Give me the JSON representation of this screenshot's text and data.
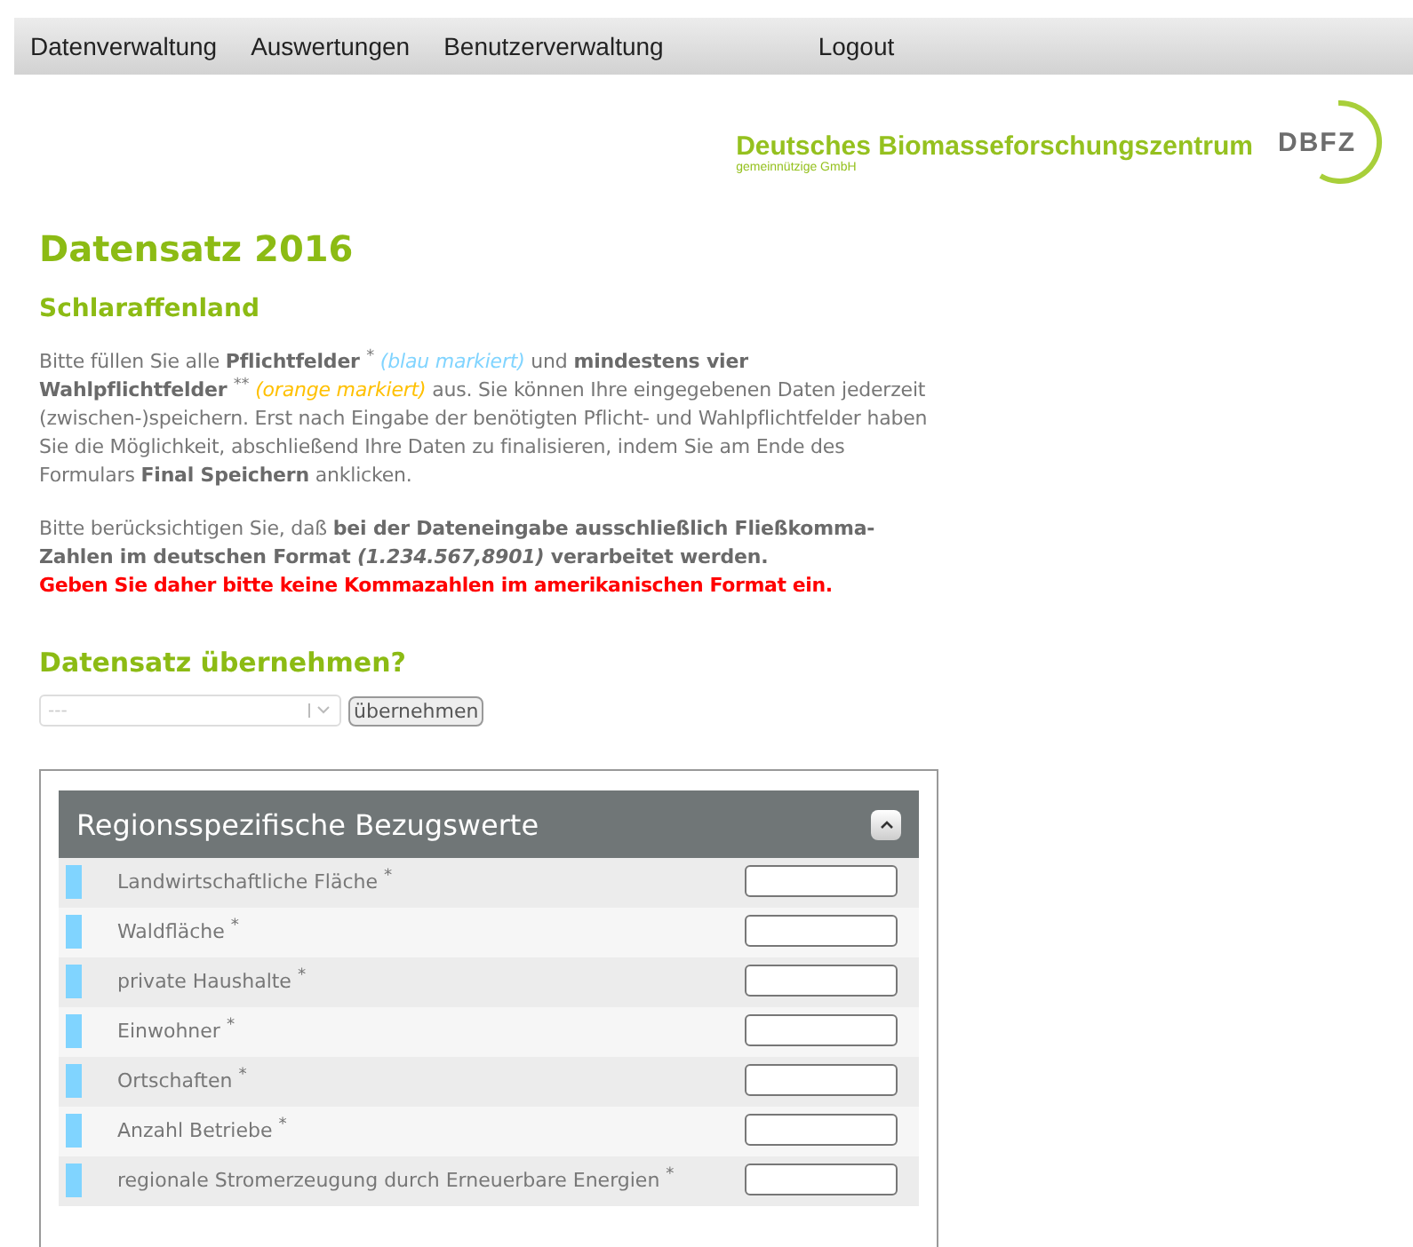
{
  "nav": [
    {
      "label": "Datenverwaltung"
    },
    {
      "label": "Auswertungen"
    },
    {
      "label": "Benutzerverwaltung"
    },
    {
      "label": "Logout"
    }
  ],
  "logo": {
    "name": "Deutsches Biomasseforschungszentrum",
    "subtitle": "gemeinnützige GmbH",
    "mark": "DBFZ"
  },
  "title": "Datensatz 2016",
  "subtitle": "Schlaraffenland",
  "intro": [
    {
      "kind": "plain",
      "text": "Bitte füllen Sie alle "
    },
    {
      "kind": "bold",
      "text": "Pflichtfelder "
    },
    {
      "kind": "sup",
      "text": "*"
    },
    {
      "kind": "blue",
      "text": " (blau markiert)"
    },
    {
      "kind": "plain",
      "text": " und "
    },
    {
      "kind": "bold",
      "text": "mindestens vier Wahlpflichtfelder "
    },
    {
      "kind": "sup",
      "text": "**"
    },
    {
      "kind": "orange",
      "text": " (orange markiert)"
    },
    {
      "kind": "plain",
      "text": " aus. Sie können Ihre eingegebenen Daten jederzeit (zwischen-)speichern. Erst nach Eingabe der benötigten Pflicht- und Wahlpflichtfelder haben Sie die Möglichkeit, abschließend Ihre Daten zu finalisieren, indem Sie am Ende des Formulars "
    },
    {
      "kind": "bold",
      "text": "Final Speichern"
    },
    {
      "kind": "plain",
      "text": " anklicken."
    }
  ],
  "notice": [
    {
      "kind": "plain",
      "text": "Bitte berücksichtigen Sie, daß "
    },
    {
      "kind": "bold",
      "text": "bei der Dateneingabe ausschließlich Fließkomma-Zahlen im deutschen Format "
    },
    {
      "kind": "bolditalic",
      "text": "(1.234.567,8901)"
    },
    {
      "kind": "bold",
      "text": " verarbeitet werden."
    }
  ],
  "warning": "Geben Sie daher bitte keine Kommazahlen im amerikanischen Format ein.",
  "copy": {
    "heading": "Datensatz übernehmen?",
    "select_value": "---",
    "button": "übernehmen"
  },
  "section": {
    "title": "Regionsspezifische Bezugswerte",
    "expanded": true,
    "rows": [
      {
        "label": "Landwirtschaftliche Fläche $^{*}$",
        "color": "#80d4ff"
      },
      {
        "label": "Waldfläche $^{*}$",
        "color": "#80d4ff"
      },
      {
        "label": "private Haushalte $^{*}$",
        "color": "#80d4ff"
      },
      {
        "label": "Einwohner $^{*}$",
        "color": "#80d4ff"
      },
      {
        "label": "Ortschaften $^{*}$",
        "color": "#80d4ff"
      },
      {
        "label": "Anzahl Betriebe $^{*}$",
        "color": "#80d4ff"
      },
      {
        "label": "regionale Stromerzeugung durch Erneuerbare Energien $^{*}$",
        "color": "#80d4ff"
      }
    ]
  }
}
